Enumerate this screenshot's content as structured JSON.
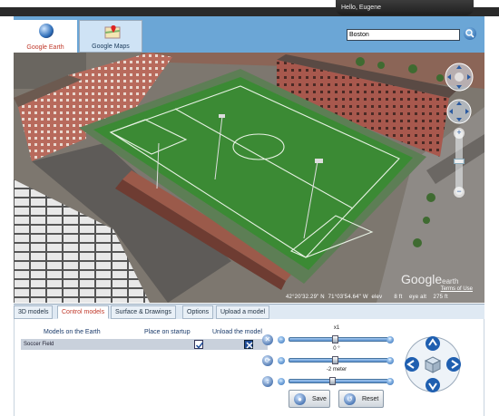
{
  "header": {
    "greeting": "Hello, Eugene",
    "tabs": [
      {
        "label": "Google Earth",
        "active": true,
        "icon": "globe-icon"
      },
      {
        "label": "Google Maps",
        "active": false,
        "icon": "maps-pin-icon"
      }
    ],
    "search": {
      "value": "Boston",
      "icon": "search-icon"
    }
  },
  "map": {
    "status": {
      "coords": "42°20'32.29\" N",
      "lon": "71°03'54.64\" W",
      "elev_label": "elev",
      "elev_value": "8 ft",
      "eye_label": "eye alt",
      "eye_value": "275 ft"
    },
    "brand": "Google",
    "brand_suffix": "earth",
    "terms": "Terms of Use",
    "controls": [
      "look-around-icon",
      "move-icon",
      "zoom-in-icon",
      "zoom-out-icon"
    ]
  },
  "bottom_tabs": [
    {
      "label": "3D models",
      "active": false
    },
    {
      "label": "Control models",
      "active": true
    },
    {
      "label": "Surface & Drawings",
      "active": false
    },
    {
      "label": "Options",
      "active": false
    },
    {
      "label": "Upload a model",
      "active": false
    }
  ],
  "models_table": {
    "headers": [
      "Models on the Earth",
      "Place on startup",
      "Unload the model"
    ],
    "rows": [
      {
        "name": "Soccer Field",
        "place_on_startup": true,
        "unload": true
      }
    ]
  },
  "controls": {
    "scale": {
      "value": "x1",
      "fraction": 0.45
    },
    "rotation": {
      "value": "0 °",
      "fraction": 0.45
    },
    "elevation": {
      "value": "-2 meter",
      "fraction": 0.42
    },
    "buttons": {
      "save": "Save",
      "reset": "Reset"
    }
  },
  "colors": {
    "accent": "#6ba6d6",
    "field": "#3b8a34",
    "active_tab_text": "#c0392b"
  }
}
